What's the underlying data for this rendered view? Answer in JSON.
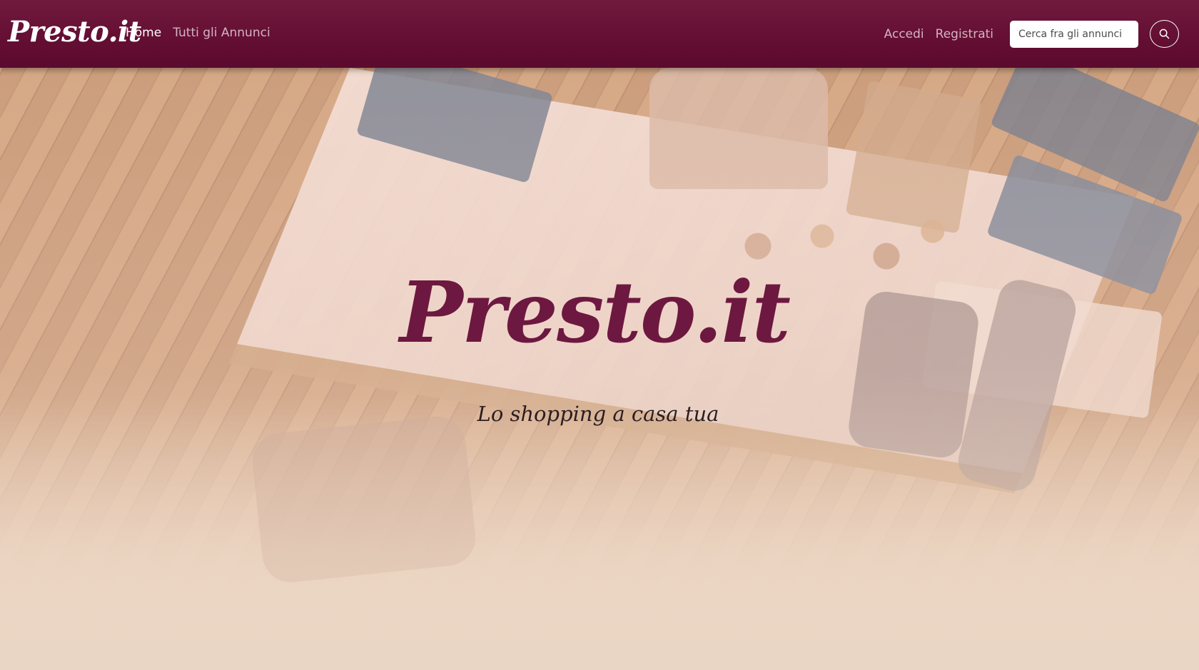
{
  "navbar": {
    "brand": "Presto.it",
    "links": [
      {
        "label": "Home",
        "active": true
      },
      {
        "label": "Tutti gli Annunci",
        "active": false
      }
    ],
    "auth": {
      "login": "Accedi",
      "register": "Registrati"
    },
    "search": {
      "placeholder": "Cerca fra gli annunci",
      "button_icon": "search-icon"
    }
  },
  "hero": {
    "title": "Presto.it",
    "subtitle": "Lo shopping a casa tua",
    "background_image": "clothing-store-overhead-photo"
  },
  "colors": {
    "navbar": "#640f33",
    "title": "#6d1840",
    "background": "#ead6c4"
  }
}
